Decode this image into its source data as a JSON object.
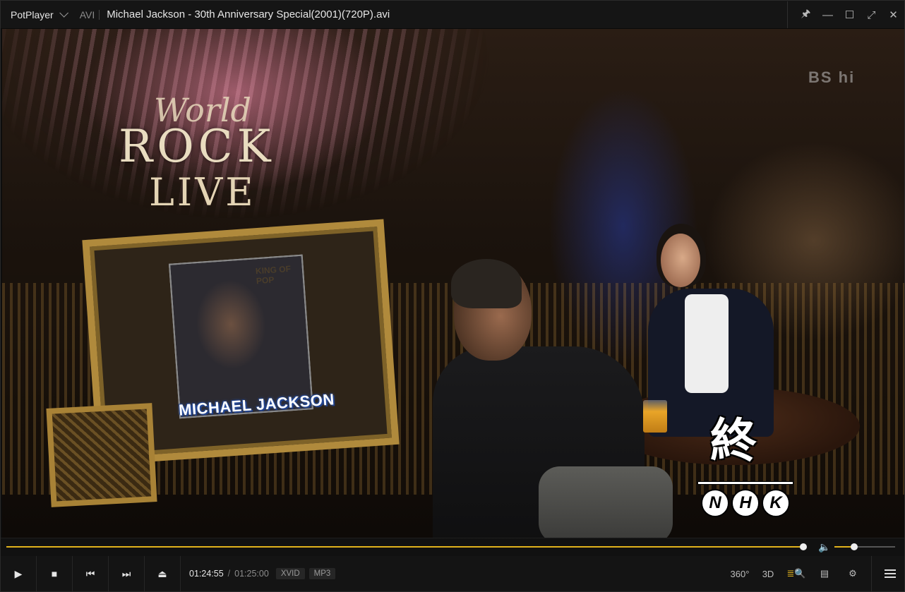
{
  "titlebar": {
    "app_name": "PotPlayer",
    "format": "AVI",
    "file_title": "Michael Jackson - 30th Anniversary Special(2001)(720P).avi",
    "buttons": {
      "pin": "🖈",
      "minimize": "—",
      "maximize": "☐",
      "fullscreen": "⤢",
      "close": "✕"
    }
  },
  "video": {
    "overlay_world": "World",
    "overlay_rock": "ROCK",
    "overlay_live": "LIVE",
    "channel_logo": "BS hi",
    "poster_subtitle": "KING OF POP",
    "poster_caption": "MICHAEL JACKSON",
    "end_text": "終",
    "network_letters": [
      "N",
      "H",
      "K"
    ]
  },
  "seek": {
    "progress": 0.9993,
    "volume": 0.32
  },
  "controls": {
    "current_time": "01:24:55",
    "separator": "/",
    "total_time": "01:25:00",
    "video_codec": "XVID",
    "audio_codec": "MP3",
    "icons": {
      "play": "▶",
      "stop": "■",
      "previous": "⏮",
      "next": "⏭",
      "eject": "⏏",
      "vr360": "360°",
      "threeD": "3D",
      "playlist_search": "≣🔍",
      "subtitles": "▤",
      "settings": "⚙"
    }
  },
  "colors": {
    "accent": "#e0b21c",
    "bar_bg": "#141414"
  }
}
